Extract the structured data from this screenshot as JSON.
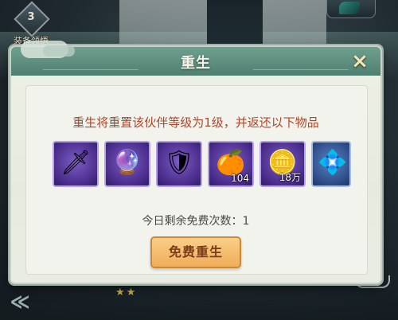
{
  "badge": {
    "level": "3",
    "label": "装备领悟"
  },
  "dialog": {
    "title": "重生",
    "close_icon": "×",
    "description": "重生将重置该伙伴等级为1级，并返还以下物品",
    "items": [
      {
        "icon": "sword-icon",
        "glyph": "🗡",
        "quality": "purple",
        "qty": ""
      },
      {
        "icon": "amulet-icon",
        "glyph": "🔮",
        "quality": "purple",
        "qty": ""
      },
      {
        "icon": "armor-icon",
        "glyph": "🛡",
        "quality": "purple",
        "qty": ""
      },
      {
        "icon": "experience-fruit-icon",
        "glyph": "🍊",
        "quality": "purple",
        "qty": "104"
      },
      {
        "icon": "silver-coin-icon",
        "glyph": "🪙",
        "quality": "purple",
        "qty": "18万"
      },
      {
        "icon": "spirit-orb-icon",
        "glyph": "💠",
        "quality": "blue",
        "qty": ""
      }
    ],
    "free_count_text": "今日剩余免费次数：1",
    "rebirth_button": "免费重生"
  },
  "bottom": {
    "stars": "★★",
    "back_icon": "≪"
  }
}
